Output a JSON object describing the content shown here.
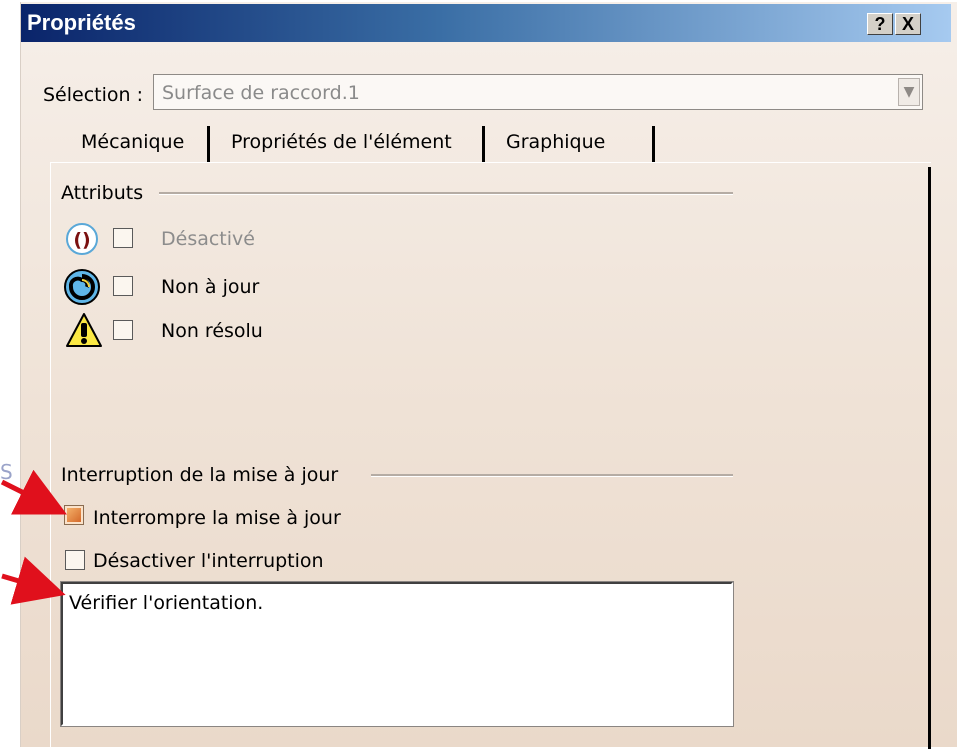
{
  "window": {
    "title": "Propriétés",
    "help_label": "?",
    "close_label": "X"
  },
  "selection": {
    "label": "Sélection :",
    "value": "Surface de raccord.1"
  },
  "tabs": [
    {
      "label": "Mécanique",
      "active": true
    },
    {
      "label": "Propriétés de l'élément",
      "active": false
    },
    {
      "label": "Graphique",
      "active": false
    }
  ],
  "attributs": {
    "title": "Attributs",
    "items": [
      {
        "label": "Désactivé",
        "icon": "deactivated-parentheses-icon",
        "checked": false,
        "enabled": false
      },
      {
        "label": "Non à jour",
        "icon": "update-spiral-icon",
        "checked": false,
        "enabled": true
      },
      {
        "label": "Non résolu",
        "icon": "warning-icon",
        "checked": false,
        "enabled": true
      }
    ]
  },
  "interruption": {
    "title": "Interruption de la mise à jour",
    "interrompre_label": "Interrompre la mise à jour",
    "interrompre_checked": true,
    "desactiver_label": "Désactiver l'interruption",
    "desactiver_checked": false,
    "message": "Vérifier l'orientation."
  },
  "annotations": {
    "arrow_color": "#e0101c"
  },
  "colors": {
    "title_bar_start": "#0a246a",
    "title_bar_end": "#a6caf0",
    "dialog_bg": "#efe2d6"
  }
}
